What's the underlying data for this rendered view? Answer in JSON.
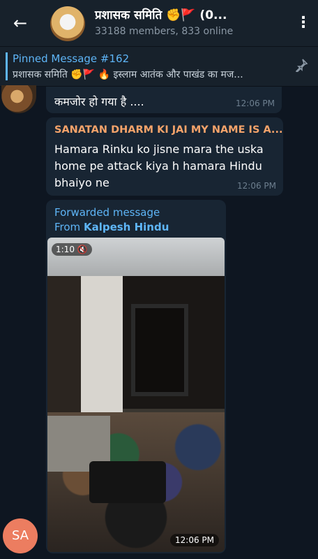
{
  "header": {
    "back_icon": "←",
    "title": "प्रशासक समिति ✊🚩 (0...",
    "subtitle": "33188 members, 833 online",
    "more_icon": "⋮"
  },
  "pinned": {
    "title": "Pinned Message #162",
    "text": "प्रशासक समिति ✊🚩 🔥 इस्लाम आतंक और पाखंड का मज...",
    "icon": "pin-icon"
  },
  "messages": [
    {
      "text": "कमजोर हो गया है ....",
      "time": "12:06 PM"
    },
    {
      "sender": "SANATAN DHARM KI JAI MY NAME IS A...",
      "text": "Hamara Rinku ko  jisne mara the uska home pe attack kiya h hamara Hindu bhaiyo ne",
      "time": "12:06 PM"
    },
    {
      "forwarded_label": "Forwarded message",
      "from_label": "From",
      "from_name": "Kalpesh Hindu",
      "video_duration": "1:10",
      "time": "12:06 PM"
    }
  ],
  "avatars": {
    "sender_initials": "SA"
  },
  "colors": {
    "background": "#0e1621",
    "header": "#17212b",
    "bubble": "#182533",
    "link": "#5eb5f7",
    "sender_name": "#f5a36a",
    "initials_avatar": "#ec7d60"
  }
}
